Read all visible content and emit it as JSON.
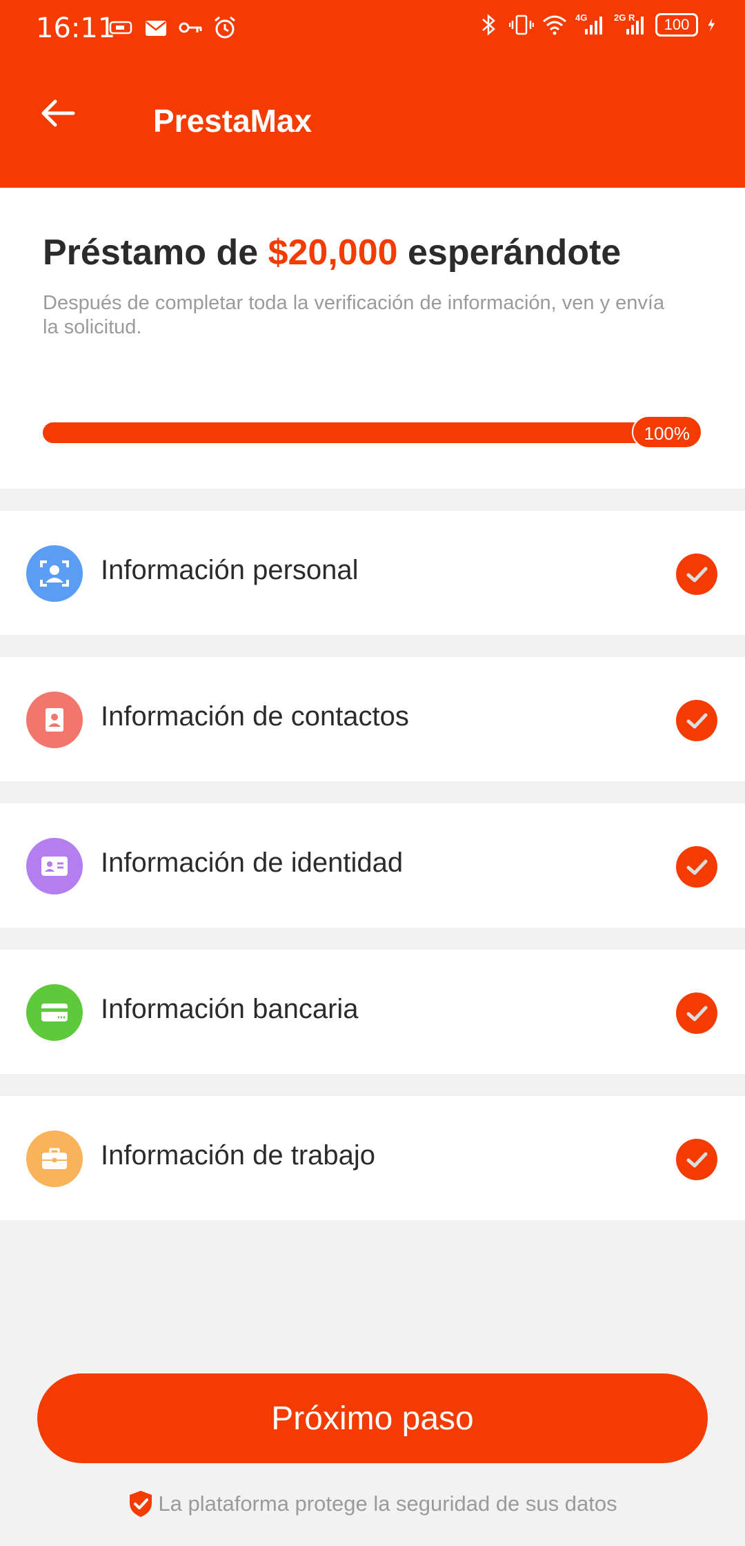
{
  "status_bar": {
    "time": "16:11",
    "battery": "100",
    "network_1": "4G",
    "network_2": "2G R",
    "icons": [
      "sim-icon",
      "mail-icon",
      "key-icon",
      "alarm-icon",
      "bluetooth-icon",
      "vibrate-icon",
      "wifi-icon",
      "signal-icon",
      "signal-icon",
      "battery-icon",
      "charging-icon"
    ]
  },
  "app_bar": {
    "title": "PrestaMax",
    "back_icon": "arrow-left-icon"
  },
  "hero": {
    "title_prefix": "Préstamo de",
    "amount": "$20,000",
    "title_suffix": "esperándote",
    "subtitle": "Después de completar toda la verificación de información, ven y envía la solicitud.",
    "progress_label": "100%",
    "progress_fraction": 1.0
  },
  "steps": [
    {
      "label": "Información personal",
      "icon": "face-scan-icon",
      "color": "#5b9cf5",
      "completed": true
    },
    {
      "label": "Información de contactos",
      "icon": "contact-book-icon",
      "color": "#f2766b",
      "completed": true
    },
    {
      "label": "Información de identidad",
      "icon": "id-card-icon",
      "color": "#b37ff0",
      "completed": true
    },
    {
      "label": "Información bancaria",
      "icon": "bank-card-icon",
      "color": "#5dc93b",
      "completed": true
    },
    {
      "label": "Información de trabajo",
      "icon": "briefcase-icon",
      "color": "#f9b35a",
      "completed": true
    }
  ],
  "next_button": {
    "label": "Próximo paso"
  },
  "footer": {
    "text": "La plataforma protege la seguridad de sus datos"
  },
  "colors": {
    "accent": "#f43c02",
    "background": "#f2f2f2",
    "text": "#2b2b2b",
    "muted": "#9a9a9a"
  }
}
